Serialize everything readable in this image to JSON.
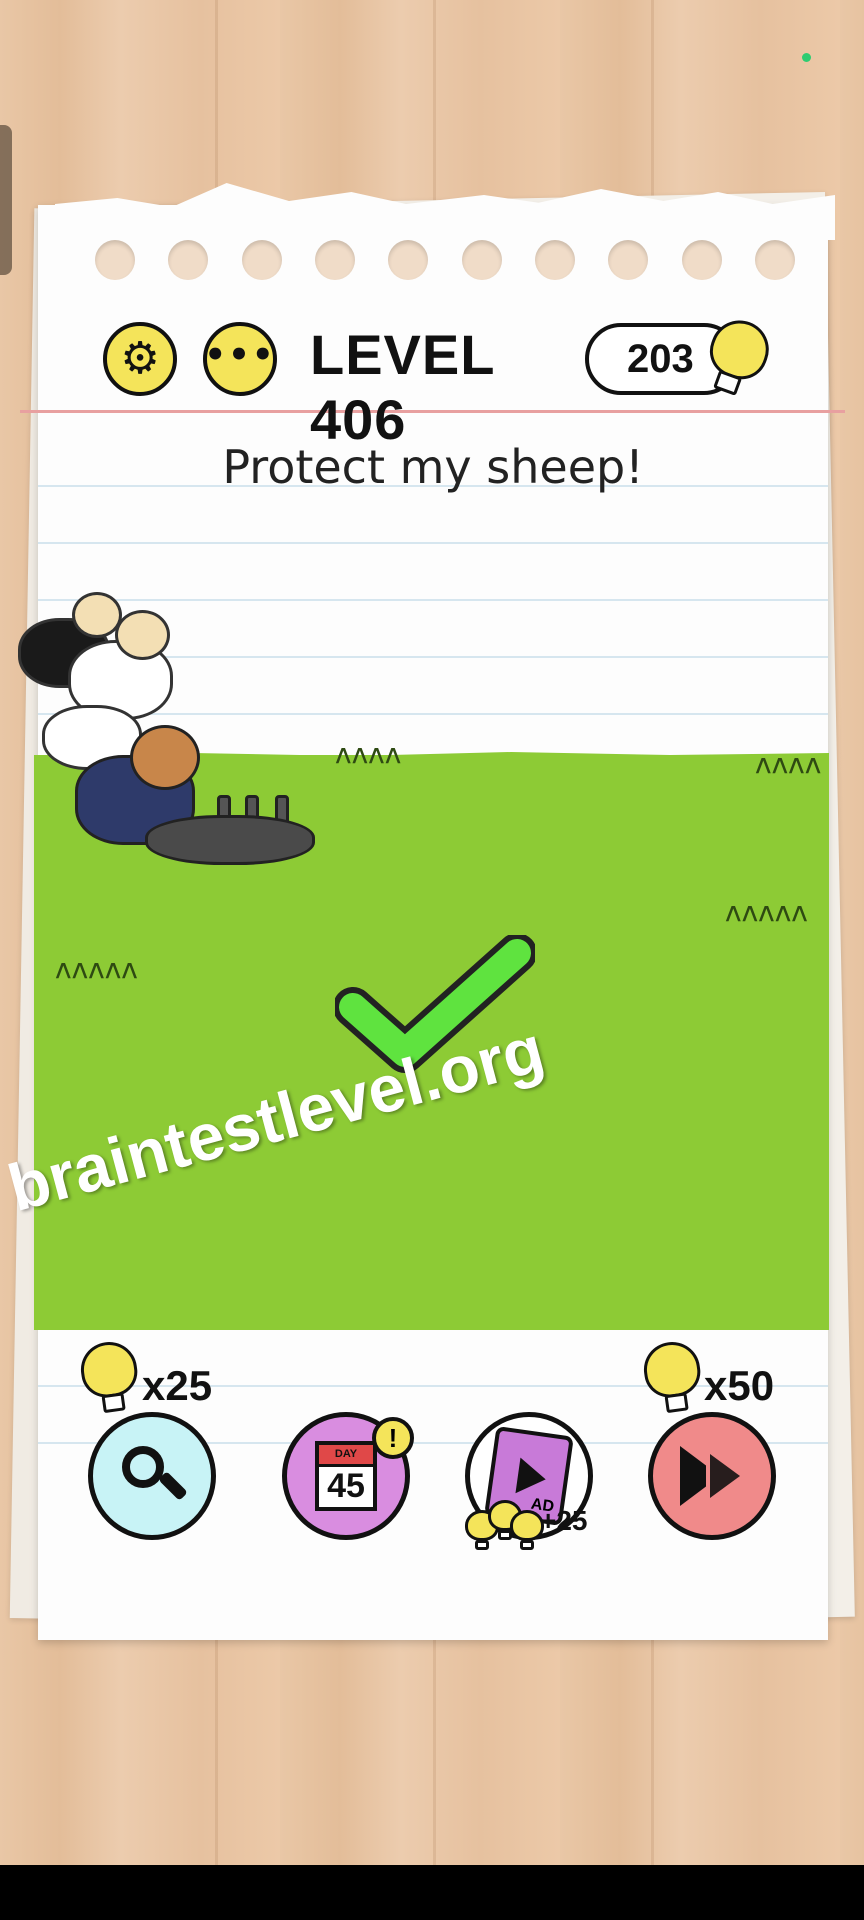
{
  "header": {
    "level_label": "LEVEL 406",
    "hint_count": "203",
    "settings_icon": "gear-icon",
    "menu_icon": "more-dots-icon",
    "hint_icon": "lightbulb-icon"
  },
  "question": "Protect my sheep!",
  "result_icon": "green-checkmark-icon",
  "watermark": "braintestlevel.org",
  "tools": {
    "hint": {
      "icon": "magnifier-icon",
      "cost": "x25"
    },
    "daily": {
      "icon": "calendar-icon",
      "day_label": "DAY",
      "day_number": "45",
      "badge": "!"
    },
    "ad": {
      "icon": "film-play-icon",
      "tag": "AD",
      "reward": "+25"
    },
    "skip": {
      "icon": "fast-forward-icon",
      "cost": "x50"
    }
  },
  "colors": {
    "grass": "#8dcb35",
    "bulb": "#f4e45a",
    "check": "#5fe33f",
    "hint_button": "#c8f3f6",
    "daily_button": "#d98de0",
    "skip_button": "#f08a8a"
  }
}
